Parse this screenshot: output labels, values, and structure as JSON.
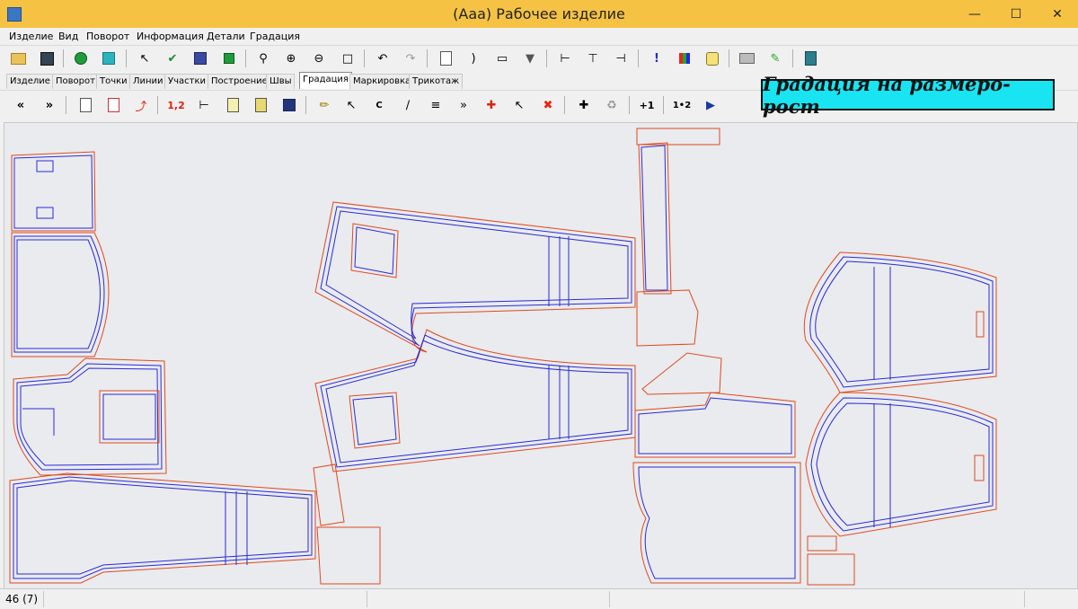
{
  "window": {
    "title": "(Ааа) Рабочее изделие",
    "minimize_icon": "minimize-icon",
    "maximize_icon": "maximize-icon",
    "close_icon": "close-icon"
  },
  "menu": [
    "Изделие",
    "Вид",
    "Поворот",
    "Информация",
    "Детали",
    "Градация"
  ],
  "main_toolbar_icons": [
    "open-folder-icon",
    "save-icon",
    "green-circle-icon",
    "layers-icon",
    "pointer-icon",
    "checkmark-icon",
    "blue-square-icon",
    "green-squares-icon",
    "zoom-icon",
    "zoom-in-icon",
    "zoom-out-icon",
    "zoom-fit-icon",
    "undo-icon",
    "redo-icon",
    "page-icon",
    "arc-icon",
    "shape-icon",
    "dropdown-icon",
    "measure-icon",
    "measure-2-icon",
    "measure-3-icon",
    "exclamation-icon",
    "color-grid-icon",
    "cylinder-icon",
    "print-icon",
    "pen-icon",
    "exit-icon"
  ],
  "tabs": [
    {
      "label": "Изделие",
      "active": false
    },
    {
      "label": "Поворот",
      "active": false
    },
    {
      "label": "Точки",
      "active": false
    },
    {
      "label": "Линии",
      "active": false
    },
    {
      "label": "Участки",
      "active": false
    },
    {
      "label": "Построение",
      "active": false
    },
    {
      "label": "Швы",
      "active": false
    },
    {
      "label": "Градация",
      "active": true
    },
    {
      "label": "Маркировка",
      "active": false
    },
    {
      "label": "Трикотаж",
      "active": false
    }
  ],
  "grading_toolbar": {
    "step_label": "1,2",
    "c_label": "C",
    "plus1_label": "+1",
    "one_two_label": "1•2"
  },
  "banner": {
    "text": "Градация на размеро-рост"
  },
  "status": {
    "count": "46 (7)"
  },
  "colors": {
    "titlebar": "#f5c244",
    "banner": "#19e4f2",
    "cut_line": "#e04a1f",
    "grade_line": "#2a2ad8",
    "canvas": "#e9ebee"
  }
}
